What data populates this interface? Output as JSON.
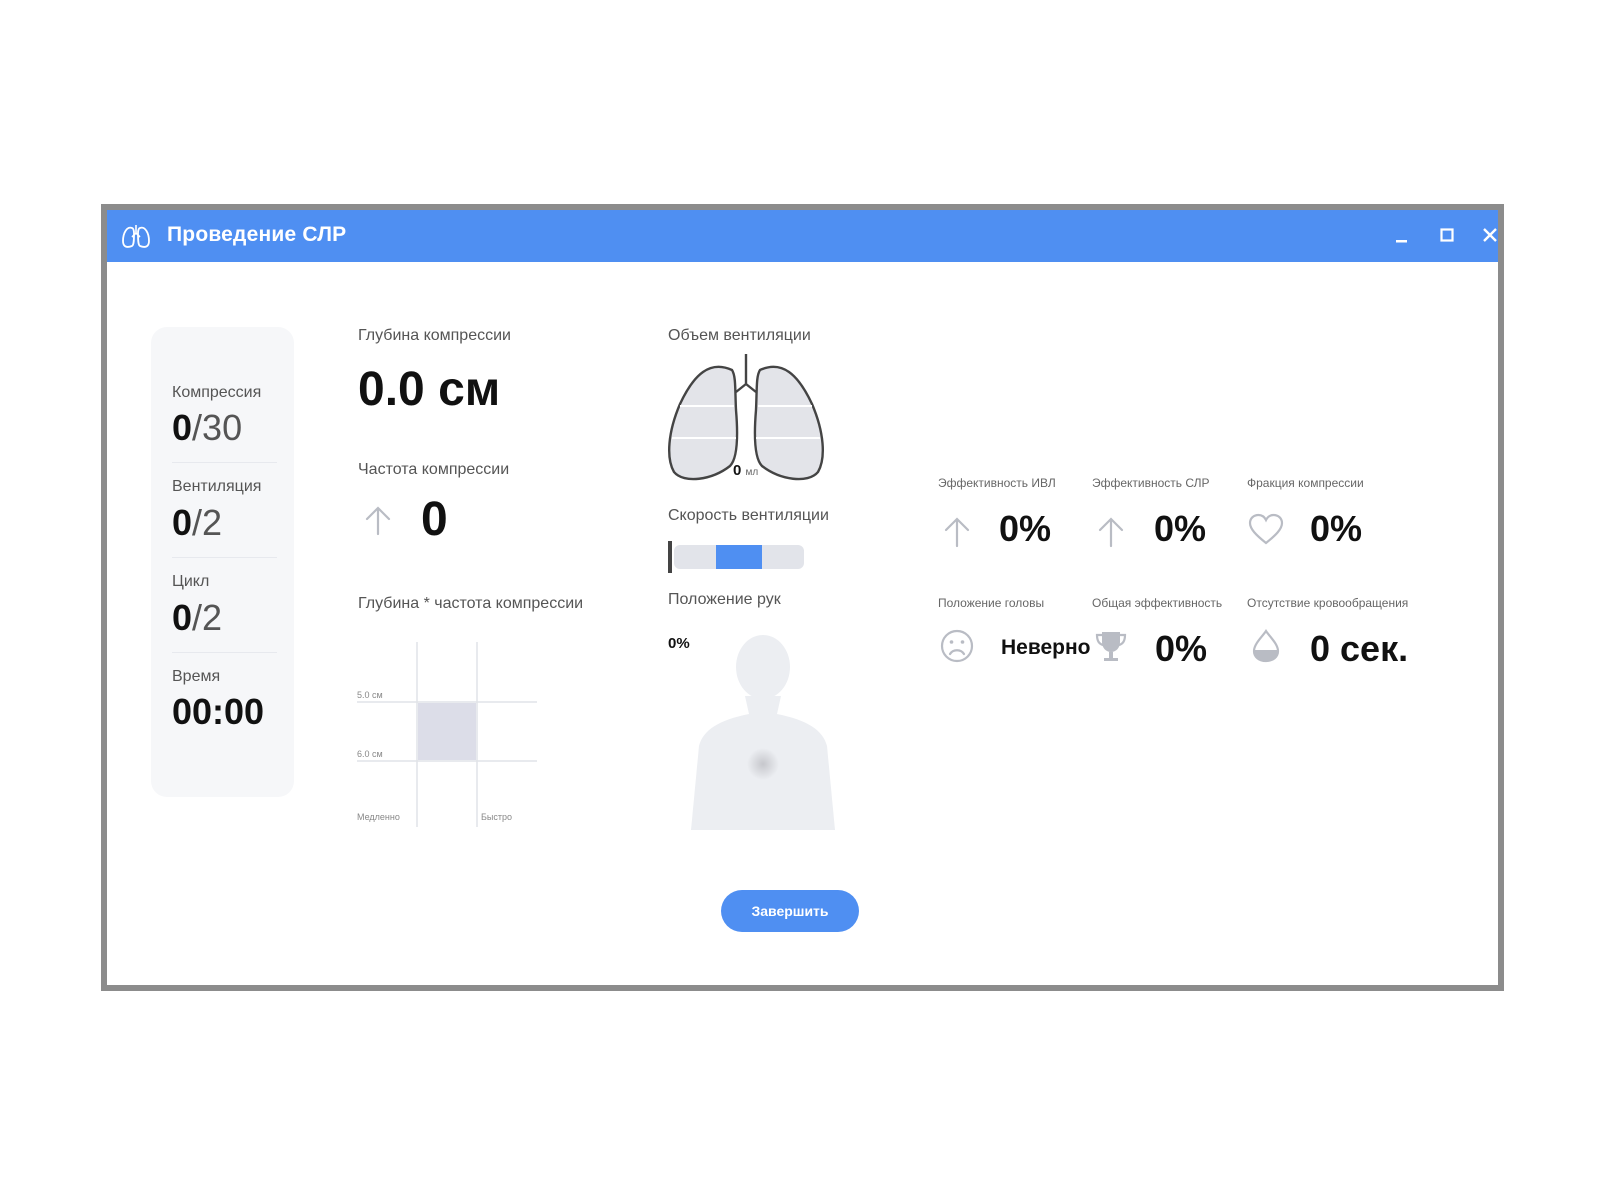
{
  "window": {
    "title": "Проведение СЛР",
    "accent_color": "#4f8ff2",
    "app_icon": "lungs-icon",
    "controls": [
      "minimize-icon",
      "maximize-icon",
      "close-icon"
    ]
  },
  "stats": [
    {
      "label": "Компрессия",
      "current": "0",
      "max": "30"
    },
    {
      "label": "Вентиляция",
      "current": "0",
      "max": "2"
    },
    {
      "label": "Цикл",
      "current": "0",
      "max": "2"
    }
  ],
  "time": {
    "label": "Время",
    "value": "00:00"
  },
  "compression": {
    "depth_label": "Глубина компрессии",
    "depth_value": "0.0 см",
    "rate_label": "Частота компрессии",
    "rate_value": "0",
    "grid_label": "Глубина * частота компрессии",
    "grid_y_ticks": [
      "5.0 см",
      "6.0 см"
    ],
    "grid_x_ticks": [
      "Медленно",
      "Быстро"
    ]
  },
  "ventilation": {
    "volume_label": "Объем вентиляции",
    "volume_value": "0",
    "volume_unit": "мл",
    "speed_label": "Скорость вентиляции",
    "speed_level": 0.5,
    "hands_label": "Положение рук",
    "hands_value": "0%"
  },
  "metrics": [
    {
      "label": "Эффективность ИВЛ",
      "value": "0%",
      "icon": "arrow-up-icon"
    },
    {
      "label": "Эффективность СЛР",
      "value": "0%",
      "icon": "arrow-up-icon"
    },
    {
      "label": "Фракция компрессии",
      "value": "0%",
      "icon": "heart-icon"
    },
    {
      "label": "Положение головы",
      "value": "Неверно",
      "icon": "sad-face-icon"
    },
    {
      "label": "Общая эффективность",
      "value": "0%",
      "icon": "trophy-icon"
    },
    {
      "label": "Отсутствие кровообращения",
      "value": "0 сек.",
      "icon": "drop-icon"
    }
  ],
  "finish_button": "Завершить"
}
